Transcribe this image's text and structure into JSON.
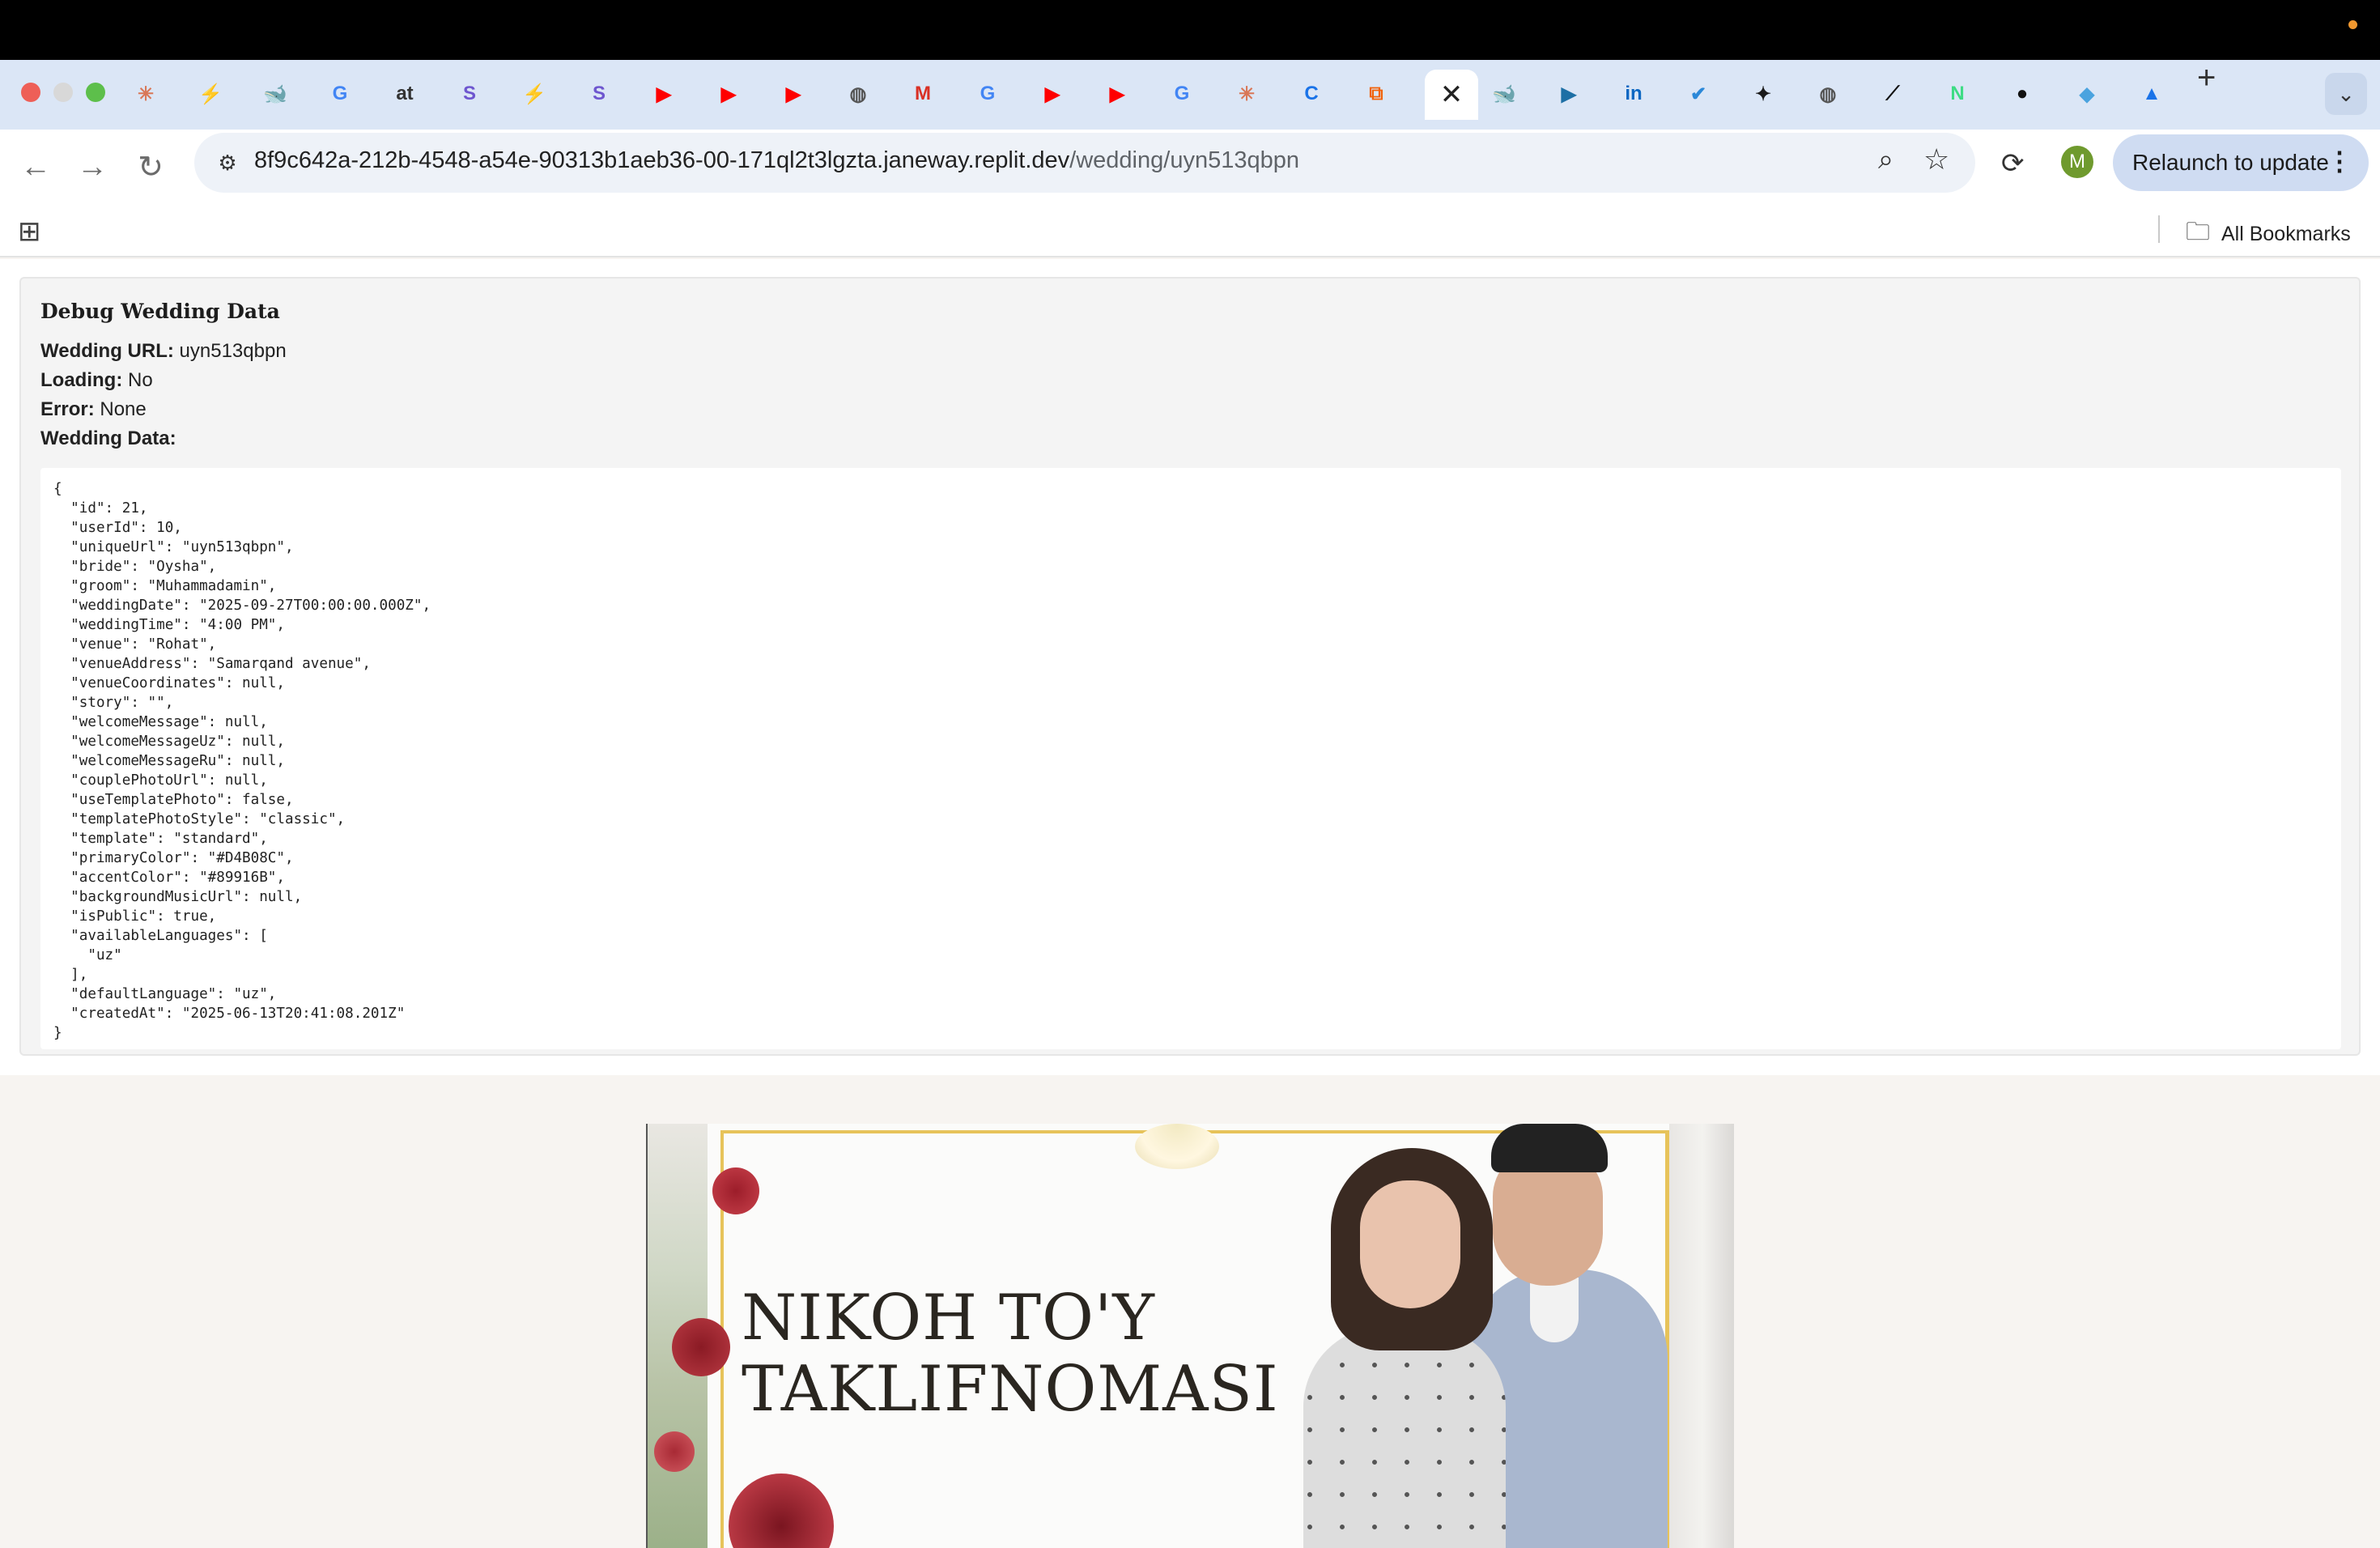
{
  "browser": {
    "url_host": "8f9c642a-212b-4548-a54e-90313b1aeb36-00-171ql2t3lgzta.janeway.replit.dev",
    "url_path": "/wedding/uyn513qbpn",
    "relaunch_label": "Relaunch to update",
    "avatar_initial": "M",
    "all_bookmarks_label": "All Bookmarks",
    "active_tab_close": "✕",
    "new_tab": "+",
    "tabs": [
      {
        "icon": "claude-icon",
        "glyph": "✳",
        "color": "#d97757"
      },
      {
        "icon": "bolt-icon",
        "glyph": "⚡",
        "color": "#1a1a1a"
      },
      {
        "icon": "deepseek-icon",
        "glyph": "🐋",
        "color": "#4d6bfe"
      },
      {
        "icon": "google-icon",
        "glyph": "G",
        "color": "#4285f4"
      },
      {
        "icon": "at-icon",
        "glyph": "at",
        "color": "#333333"
      },
      {
        "icon": "s-icon",
        "glyph": "S",
        "color": "#6e56cf"
      },
      {
        "icon": "bolt-icon",
        "glyph": "⚡",
        "color": "#1a1a1a"
      },
      {
        "icon": "s-icon",
        "glyph": "S",
        "color": "#6e56cf"
      },
      {
        "icon": "youtube-icon",
        "glyph": "▶",
        "color": "#ff0000"
      },
      {
        "icon": "youtube-icon",
        "glyph": "▶",
        "color": "#ff0000"
      },
      {
        "icon": "youtube-icon",
        "glyph": "▶",
        "color": "#ff0000"
      },
      {
        "icon": "globe-icon",
        "glyph": "◍",
        "color": "#555555"
      },
      {
        "icon": "gmail-icon",
        "glyph": "M",
        "color": "#d93025"
      },
      {
        "icon": "google-icon",
        "glyph": "G",
        "color": "#4285f4"
      },
      {
        "icon": "youtube-icon",
        "glyph": "▶",
        "color": "#ff0000"
      },
      {
        "icon": "youtube-icon",
        "glyph": "▶",
        "color": "#ff0000"
      },
      {
        "icon": "google-icon",
        "glyph": "G",
        "color": "#4285f4"
      },
      {
        "icon": "claude-icon",
        "glyph": "✳",
        "color": "#d97757"
      },
      {
        "icon": "c-icon",
        "glyph": "C",
        "color": "#1a73e8"
      },
      {
        "icon": "replit-icon",
        "glyph": "⧉",
        "color": "#f26207"
      },
      {
        "icon": "active-tab",
        "glyph": "",
        "color": "#222222"
      },
      {
        "icon": "deepseek-icon",
        "glyph": "🐋",
        "color": "#4d6bfe"
      },
      {
        "icon": "video-icon",
        "glyph": "▶",
        "color": "#1d6fa5"
      },
      {
        "icon": "linkedin-icon",
        "glyph": "in",
        "color": "#0a66c2"
      },
      {
        "icon": "tasks-icon",
        "glyph": "✔",
        "color": "#2b88d8"
      },
      {
        "icon": "extension-icon",
        "glyph": "✦",
        "color": "#1a1a1a"
      },
      {
        "icon": "globe-icon",
        "glyph": "◍",
        "color": "#555555"
      },
      {
        "icon": "link-icon",
        "glyph": "⟋",
        "color": "#111111"
      },
      {
        "icon": "n-icon",
        "glyph": "N",
        "color": "#3ddc84"
      },
      {
        "icon": "github-icon",
        "glyph": "●",
        "color": "#111111"
      },
      {
        "icon": "diamond-icon",
        "glyph": "◆",
        "color": "#4aa3df"
      },
      {
        "icon": "drive-icon",
        "glyph": "▲",
        "color": "#1a73e8"
      }
    ]
  },
  "debug": {
    "heading": "Debug Wedding Data",
    "url_label": "Wedding URL:",
    "url_value": "uyn513qbpn",
    "loading_label": "Loading:",
    "loading_value": "No",
    "error_label": "Error:",
    "error_value": "None",
    "data_label": "Wedding Data:",
    "json_text": "{\n  \"id\": 21,\n  \"userId\": 10,\n  \"uniqueUrl\": \"uyn513qbpn\",\n  \"bride\": \"Oysha\",\n  \"groom\": \"Muhammadamin\",\n  \"weddingDate\": \"2025-09-27T00:00:00.000Z\",\n  \"weddingTime\": \"4:00 PM\",\n  \"venue\": \"Rohat\",\n  \"venueAddress\": \"Samarqand avenue\",\n  \"venueCoordinates\": null,\n  \"story\": \"\",\n  \"welcomeMessage\": null,\n  \"welcomeMessageUz\": null,\n  \"welcomeMessageRu\": null,\n  \"couplePhotoUrl\": null,\n  \"useTemplatePhoto\": false,\n  \"templatePhotoStyle\": \"classic\",\n  \"template\": \"standard\",\n  \"primaryColor\": \"#D4B08C\",\n  \"accentColor\": \"#89916B\",\n  \"backgroundMusicUrl\": null,\n  \"isPublic\": true,\n  \"availableLanguages\": [\n    \"uz\"\n  ],\n  \"defaultLanguage\": \"uz\",\n  \"createdAt\": \"2025-06-13T20:41:08.201Z\"\n}"
  },
  "invitation": {
    "title_line1": "NIKOH TO'Y",
    "title_line2": "TAKLIFNOMASI"
  }
}
